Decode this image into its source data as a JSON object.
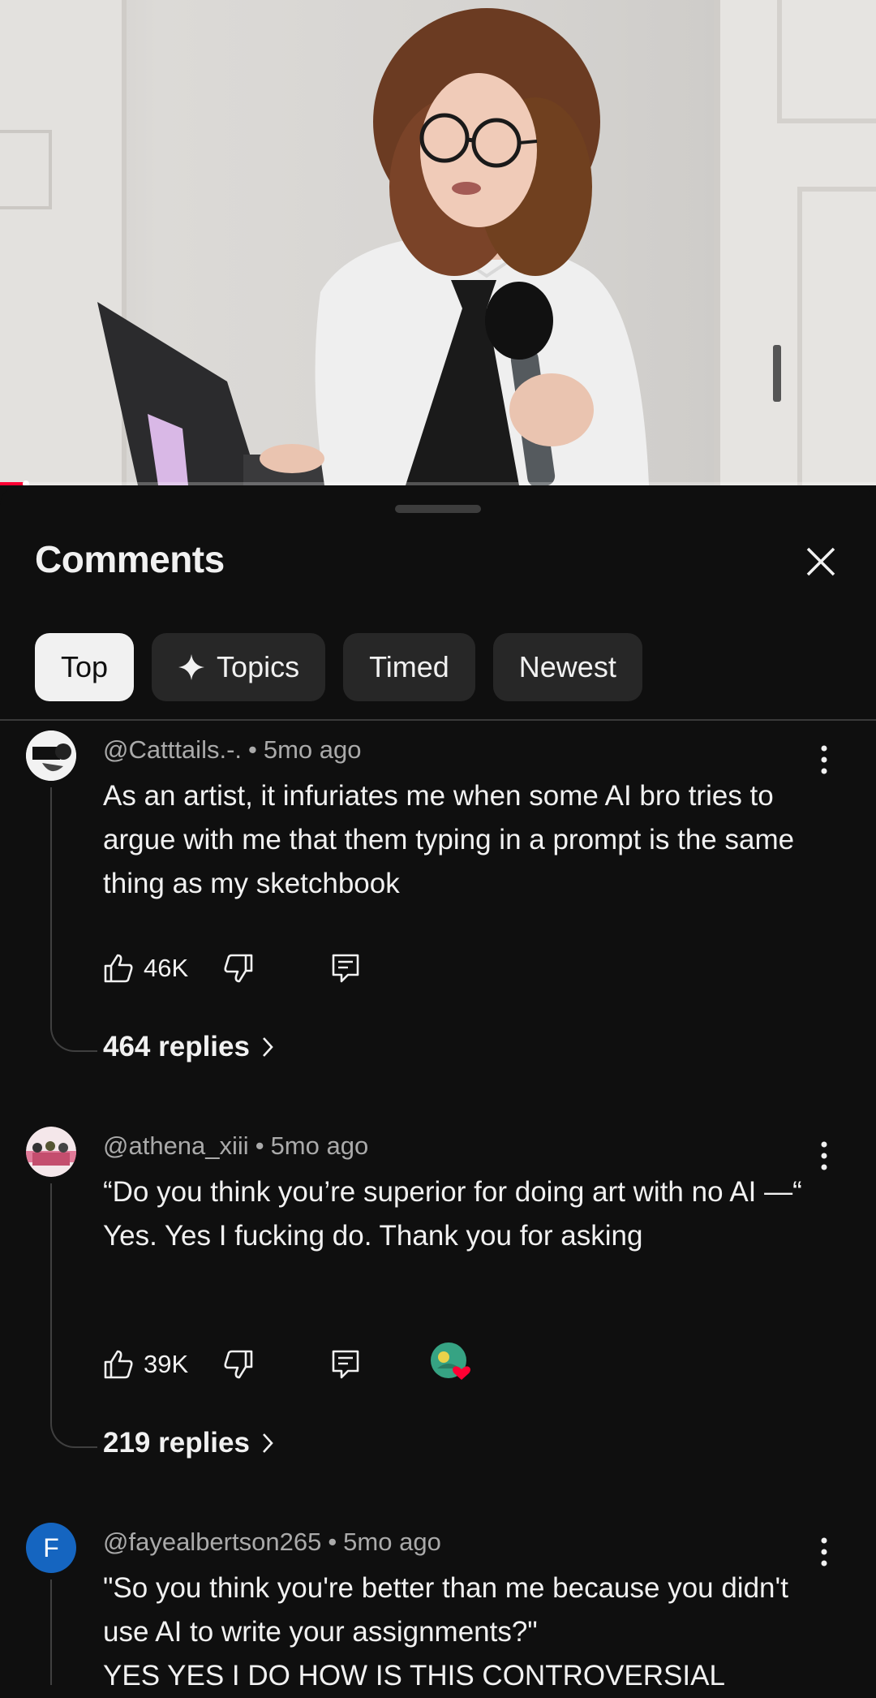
{
  "video": {
    "progress_fraction": 0.03
  },
  "sheet": {
    "title": "Comments",
    "chips": [
      {
        "label": "Top",
        "active": true
      },
      {
        "label": "Topics",
        "active": false
      },
      {
        "label": "Timed",
        "active": false
      },
      {
        "label": "Newest",
        "active": false
      }
    ]
  },
  "comments": [
    {
      "author": "@Catttails.-.",
      "age": "5mo ago",
      "text": [
        "As an artist, it infuriates me when some AI bro tries to argue with me that them typing in a prompt is the same thing as my sketchbook"
      ],
      "likes": "46K",
      "replies": "464 replies",
      "avatar_icon": "sticker-avatar"
    },
    {
      "author": "@athena_xiii",
      "age": "5mo ago",
      "text": [
        "“Do you think you’re superior for doing art with no AI —“",
        "Yes. Yes I fucking do. Thank you for asking"
      ],
      "likes": "39K",
      "replies": "219 replies",
      "avatar_icon": "group-photo-avatar",
      "creator_heart": true
    },
    {
      "author": "@fayealbertson265",
      "age": "5mo ago",
      "text": [
        "\"So you think you're better than me because you didn't use AI to write your assignments?\"",
        "YES YES I DO HOW IS THIS CONTROVERSIAL"
      ],
      "avatar_letter": "F",
      "avatar_color": "#1565c0"
    }
  ]
}
